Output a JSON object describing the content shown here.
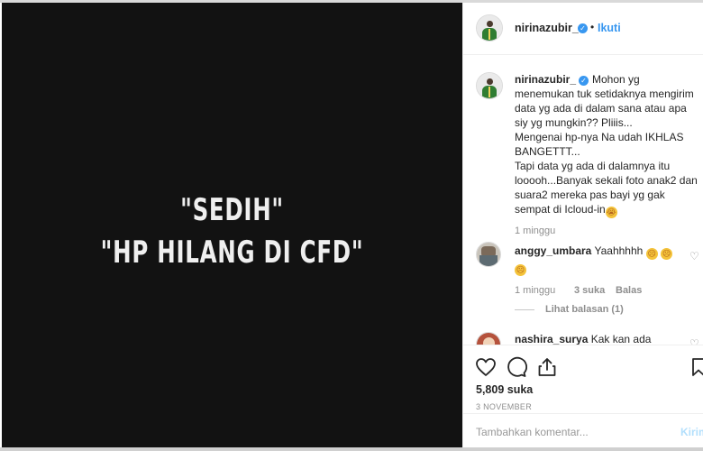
{
  "photo": {
    "line1": "\"SEDIH\"",
    "line2": "\"HP HILANG DI CFD\""
  },
  "header": {
    "username": "nirinazubir_",
    "verified_icon": "verified-badge-icon",
    "separator": "•",
    "follow_label": "Ikuti"
  },
  "caption": {
    "username": "nirinazubir_",
    "paragraphs": [
      "Mohon yg menemukan tuk setidaknya mengirim data yg ada di dalam sana atau apa siy yg mungkin?? Pliiis...",
      "Mengenai hp-nya Na udah IKHLAS BANGETTT...",
      "Tapi data yg ada di dalamnya itu looooh...Banyak sekali foto anak2 dan suara2 mereka pas bayi yg gak sempat di Icloud-in"
    ],
    "time": "1 minggu"
  },
  "comments": [
    {
      "username": "anggy_umbara",
      "text": "Yaahhhhh",
      "time": "1 minggu",
      "likes": "3 suka",
      "reply": "Balas",
      "view_replies": "Lihat balasan (1)"
    },
    {
      "username": "nashira_surya",
      "text": "Kak kan ada"
    }
  ],
  "actions": {
    "likes_count": "5,809 suka",
    "date": "3 NOVEMBER"
  },
  "add_comment": {
    "placeholder": "Tambahkan komentar...",
    "post_label": "Kirim"
  },
  "colors": {
    "accent": "#3897f0",
    "photo_bg": "#121212",
    "muted": "#8e8e8e"
  }
}
